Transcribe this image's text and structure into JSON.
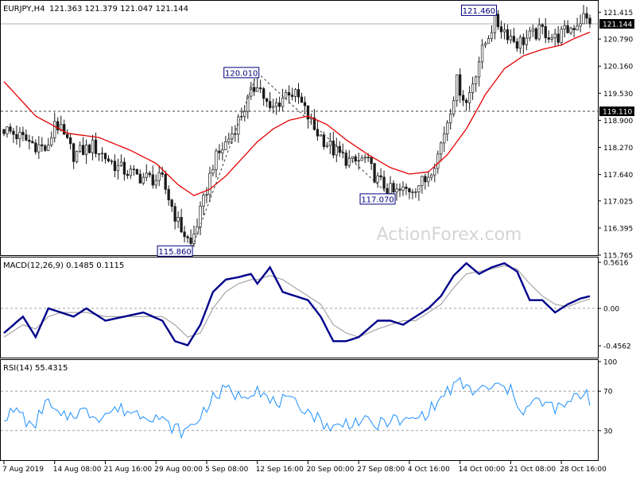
{
  "header": {
    "symbol_label": "EURJPY,H4",
    "ohlc_label": "121.363 121.379 121.047 121.144"
  },
  "watermark": "ActionForex.com",
  "colors": {
    "candle": "#1a1a1a",
    "ma": "#e60000",
    "macd_line": "#00008b",
    "macd_signal": "#a6a6a6",
    "rsi": "#1e90ff",
    "grid_dash": "#a0a0a0",
    "price_label_bg": "#000000"
  },
  "chart_data": [
    {
      "type": "candlestick",
      "panel": "price",
      "ylim": [
        115.765,
        121.68
      ],
      "yticks": [
        "121.415",
        "120.790",
        "120.160",
        "119.530",
        "118.900",
        "118.270",
        "117.640",
        "117.025",
        "116.395",
        "115.765"
      ],
      "yticks_values": [
        121.415,
        120.79,
        120.16,
        119.53,
        118.9,
        118.27,
        117.64,
        117.025,
        116.395,
        115.765
      ],
      "current_price": 121.144,
      "current_price_label": "121.144",
      "hline": 119.11,
      "hline_label": "119.110",
      "annotations": [
        {
          "label": "120.010",
          "x": 80,
          "y": 120.01,
          "anchor": "right"
        },
        {
          "label": "115.860",
          "x": 59,
          "y": 115.86,
          "anchor": "right"
        },
        {
          "label": "117.070",
          "x": 123,
          "y": 117.07,
          "anchor": "right"
        },
        {
          "label": "121.460",
          "x": 155,
          "y": 121.46,
          "anchor": "right"
        }
      ],
      "trendlines": [
        {
          "x": [
            59,
            80
          ],
          "y": [
            115.86,
            120.01
          ]
        },
        {
          "x": [
            80,
            123
          ],
          "y": [
            120.01,
            117.07
          ]
        }
      ],
      "close_anchors": [
        [
          0,
          118.7
        ],
        [
          8,
          118.4
        ],
        [
          14,
          118.2
        ],
        [
          16,
          118.9
        ],
        [
          22,
          118.1
        ],
        [
          28,
          118.3
        ],
        [
          36,
          117.8
        ],
        [
          42,
          117.6
        ],
        [
          50,
          117.5
        ],
        [
          55,
          116.5
        ],
        [
          59,
          116.0
        ],
        [
          63,
          117.0
        ],
        [
          66,
          117.9
        ],
        [
          72,
          118.6
        ],
        [
          78,
          119.5
        ],
        [
          80,
          119.8
        ],
        [
          84,
          119.1
        ],
        [
          90,
          119.6
        ],
        [
          93,
          119.4
        ],
        [
          98,
          118.7
        ],
        [
          104,
          118.2
        ],
        [
          110,
          117.9
        ],
        [
          114,
          118.0
        ],
        [
          118,
          117.5
        ],
        [
          123,
          117.2
        ],
        [
          128,
          117.3
        ],
        [
          133,
          117.5
        ],
        [
          137,
          118.1
        ],
        [
          140,
          118.9
        ],
        [
          143,
          119.8
        ],
        [
          146,
          119.3
        ],
        [
          150,
          120.3
        ],
        [
          153,
          120.9
        ],
        [
          155,
          121.2
        ],
        [
          158,
          121.0
        ],
        [
          162,
          120.7
        ],
        [
          165,
          120.8
        ],
        [
          170,
          121.0
        ],
        [
          174,
          120.8
        ],
        [
          180,
          121.1
        ],
        [
          183,
          121.3
        ],
        [
          185,
          121.14
        ]
      ],
      "moving_average": {
        "label": "MA",
        "anchors": [
          [
            0,
            119.8
          ],
          [
            10,
            119.0
          ],
          [
            20,
            118.6
          ],
          [
            30,
            118.5
          ],
          [
            40,
            118.2
          ],
          [
            48,
            117.9
          ],
          [
            55,
            117.4
          ],
          [
            60,
            117.15
          ],
          [
            65,
            117.3
          ],
          [
            70,
            117.6
          ],
          [
            75,
            118.0
          ],
          [
            80,
            118.4
          ],
          [
            85,
            118.7
          ],
          [
            90,
            118.9
          ],
          [
            96,
            119.0
          ],
          [
            102,
            118.8
          ],
          [
            108,
            118.45
          ],
          [
            115,
            118.1
          ],
          [
            122,
            117.8
          ],
          [
            128,
            117.65
          ],
          [
            134,
            117.7
          ],
          [
            140,
            118.1
          ],
          [
            146,
            118.7
          ],
          [
            152,
            119.5
          ],
          [
            158,
            120.1
          ],
          [
            164,
            120.4
          ],
          [
            170,
            120.55
          ],
          [
            176,
            120.65
          ],
          [
            180,
            120.8
          ],
          [
            185,
            120.95
          ]
        ]
      }
    },
    {
      "type": "line",
      "panel": "macd",
      "title": "MACD(12,26,9) 0.1485 0.1115",
      "ylim": [
        -0.6,
        0.62
      ],
      "yticks": [
        "0.5616",
        "0.00",
        "-0.4562"
      ],
      "yticks_values": [
        0.5616,
        0.0,
        -0.4562
      ],
      "baseline": 0,
      "series": [
        {
          "role": "macd",
          "anchors": [
            [
              0,
              -0.3
            ],
            [
              6,
              -0.1
            ],
            [
              10,
              -0.35
            ],
            [
              14,
              0.0
            ],
            [
              18,
              -0.05
            ],
            [
              22,
              -0.1
            ],
            [
              26,
              0.0
            ],
            [
              32,
              -0.15
            ],
            [
              38,
              -0.1
            ],
            [
              44,
              -0.05
            ],
            [
              50,
              -0.15
            ],
            [
              54,
              -0.4
            ],
            [
              58,
              -0.45
            ],
            [
              62,
              -0.2
            ],
            [
              66,
              0.2
            ],
            [
              70,
              0.35
            ],
            [
              74,
              0.38
            ],
            [
              78,
              0.42
            ],
            [
              80,
              0.3
            ],
            [
              84,
              0.5
            ],
            [
              88,
              0.2
            ],
            [
              92,
              0.15
            ],
            [
              96,
              0.1
            ],
            [
              100,
              -0.1
            ],
            [
              104,
              -0.4
            ],
            [
              108,
              -0.4
            ],
            [
              112,
              -0.35
            ],
            [
              118,
              -0.15
            ],
            [
              122,
              -0.15
            ],
            [
              126,
              -0.2
            ],
            [
              130,
              -0.1
            ],
            [
              134,
              0.0
            ],
            [
              138,
              0.15
            ],
            [
              142,
              0.4
            ],
            [
              146,
              0.55
            ],
            [
              150,
              0.42
            ],
            [
              154,
              0.5
            ],
            [
              158,
              0.55
            ],
            [
              162,
              0.45
            ],
            [
              166,
              0.1
            ],
            [
              170,
              0.1
            ],
            [
              174,
              -0.05
            ],
            [
              178,
              0.05
            ],
            [
              182,
              0.12
            ],
            [
              185,
              0.1485
            ]
          ]
        },
        {
          "role": "signal",
          "anchors": [
            [
              0,
              -0.35
            ],
            [
              6,
              -0.2
            ],
            [
              10,
              -0.25
            ],
            [
              14,
              -0.1
            ],
            [
              18,
              -0.05
            ],
            [
              22,
              -0.05
            ],
            [
              26,
              -0.05
            ],
            [
              32,
              -0.1
            ],
            [
              38,
              -0.1
            ],
            [
              44,
              -0.1
            ],
            [
              50,
              -0.1
            ],
            [
              54,
              -0.2
            ],
            [
              58,
              -0.35
            ],
            [
              62,
              -0.3
            ],
            [
              66,
              0.0
            ],
            [
              70,
              0.2
            ],
            [
              74,
              0.3
            ],
            [
              78,
              0.35
            ],
            [
              80,
              0.35
            ],
            [
              84,
              0.4
            ],
            [
              88,
              0.35
            ],
            [
              92,
              0.25
            ],
            [
              96,
              0.15
            ],
            [
              100,
              0.05
            ],
            [
              104,
              -0.2
            ],
            [
              108,
              -0.3
            ],
            [
              112,
              -0.35
            ],
            [
              118,
              -0.25
            ],
            [
              122,
              -0.2
            ],
            [
              126,
              -0.15
            ],
            [
              130,
              -0.15
            ],
            [
              134,
              -0.05
            ],
            [
              138,
              0.05
            ],
            [
              142,
              0.25
            ],
            [
              146,
              0.42
            ],
            [
              150,
              0.45
            ],
            [
              154,
              0.48
            ],
            [
              158,
              0.52
            ],
            [
              162,
              0.48
            ],
            [
              166,
              0.3
            ],
            [
              170,
              0.15
            ],
            [
              174,
              0.05
            ],
            [
              178,
              0.02
            ],
            [
              182,
              0.08
            ],
            [
              185,
              0.1115
            ]
          ]
        }
      ]
    },
    {
      "type": "line",
      "panel": "rsi",
      "title": "RSI(14) 55.4315",
      "ylim": [
        0,
        100
      ],
      "yticks": [
        "100",
        "70",
        "30",
        "0"
      ],
      "yticks_values": [
        100,
        70,
        30,
        0
      ],
      "levels": [
        70,
        30
      ],
      "series": [
        {
          "role": "rsi",
          "anchors": [
            [
              0,
              45
            ],
            [
              5,
              50
            ],
            [
              9,
              30
            ],
            [
              13,
              60
            ],
            [
              18,
              42
            ],
            [
              24,
              50
            ],
            [
              30,
              45
            ],
            [
              36,
              52
            ],
            [
              42,
              48
            ],
            [
              48,
              45
            ],
            [
              52,
              35
            ],
            [
              57,
              28
            ],
            [
              61,
              40
            ],
            [
              65,
              60
            ],
            [
              70,
              72
            ],
            [
              74,
              65
            ],
            [
              78,
              70
            ],
            [
              80,
              75
            ],
            [
              84,
              58
            ],
            [
              88,
              60
            ],
            [
              94,
              55
            ],
            [
              100,
              40
            ],
            [
              104,
              32
            ],
            [
              108,
              38
            ],
            [
              112,
              40
            ],
            [
              118,
              35
            ],
            [
              122,
              42
            ],
            [
              126,
              38
            ],
            [
              132,
              45
            ],
            [
              136,
              55
            ],
            [
              140,
              70
            ],
            [
              144,
              78
            ],
            [
              148,
              70
            ],
            [
              152,
              72
            ],
            [
              156,
              75
            ],
            [
              160,
              70
            ],
            [
              164,
              50
            ],
            [
              168,
              60
            ],
            [
              172,
              55
            ],
            [
              176,
              52
            ],
            [
              180,
              62
            ],
            [
              184,
              70
            ],
            [
              185,
              55.43
            ]
          ]
        }
      ]
    }
  ],
  "x_axis": {
    "count": 186,
    "labels": [
      {
        "text": "7 Aug 2019",
        "i": 0
      },
      {
        "text": "14 Aug 08:00",
        "i": 16
      },
      {
        "text": "21 Aug 16:00",
        "i": 32
      },
      {
        "text": "29 Aug 00:00",
        "i": 48
      },
      {
        "text": "5 Sep 08:00",
        "i": 64
      },
      {
        "text": "12 Sep 16:00",
        "i": 80
      },
      {
        "text": "20 Sep 00:00",
        "i": 96
      },
      {
        "text": "27 Sep 08:00",
        "i": 112
      },
      {
        "text": "4 Oct 16:00",
        "i": 128
      },
      {
        "text": "14 Oct 00:00",
        "i": 144
      },
      {
        "text": "21 Oct 08:00",
        "i": 160
      },
      {
        "text": "28 Oct 16:00",
        "i": 176
      }
    ]
  }
}
